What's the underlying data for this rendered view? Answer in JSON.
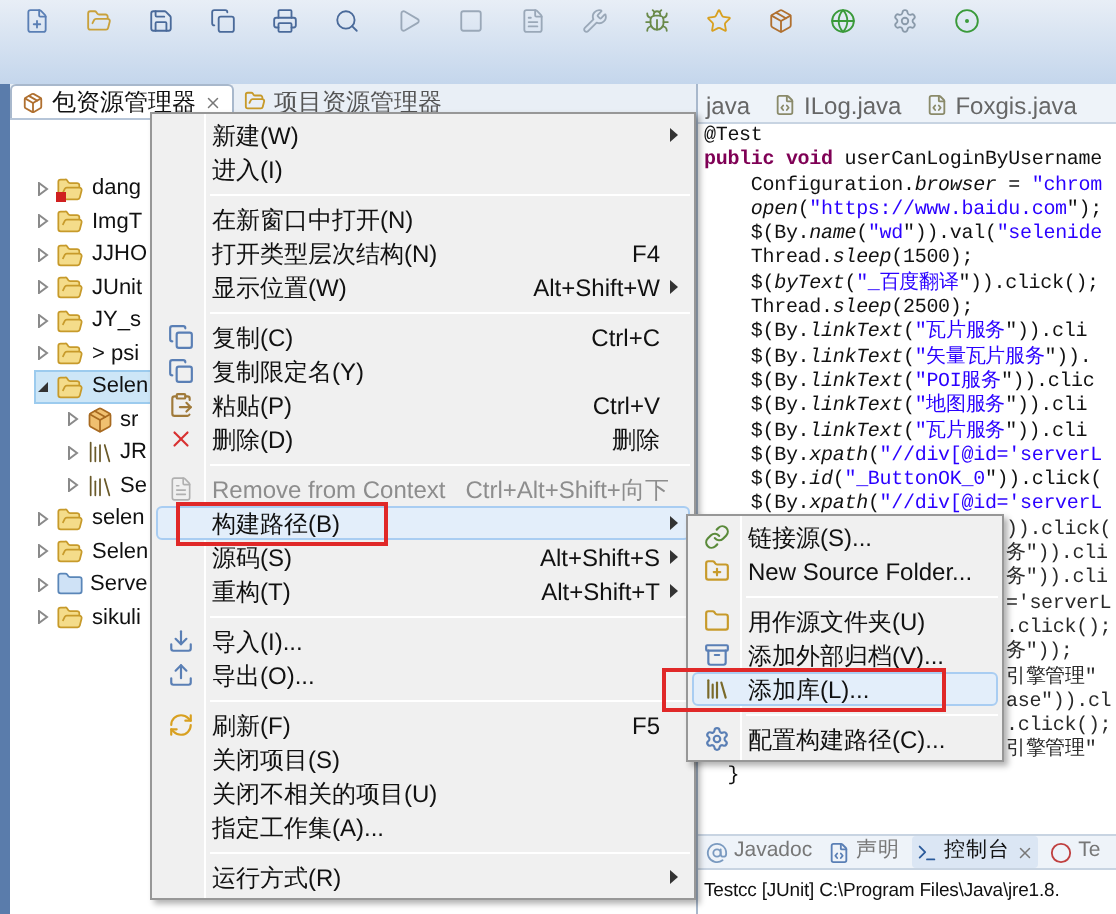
{
  "package_explorer": {
    "tabs": [
      {
        "label": "包资源管理器",
        "selected": true
      },
      {
        "label": "项目资源管理器",
        "selected": false
      }
    ],
    "tree": [
      {
        "label": "dang",
        "kind": "project-error",
        "expanded": false,
        "selected": false
      },
      {
        "label": "ImgT",
        "kind": "project",
        "expanded": false,
        "selected": false
      },
      {
        "label": "JJHO",
        "kind": "project",
        "expanded": false,
        "selected": false
      },
      {
        "label": "JUnit",
        "kind": "project",
        "expanded": false,
        "selected": false
      },
      {
        "label": "JY_s",
        "kind": "project",
        "expanded": false,
        "selected": false
      },
      {
        "label": "> psi",
        "kind": "project",
        "expanded": false,
        "selected": false
      },
      {
        "label": "Selen",
        "kind": "project",
        "expanded": true,
        "selected": true,
        "children": [
          {
            "label": "sr",
            "kind": "source",
            "expanded": false,
            "selected": false
          },
          {
            "label": "JR",
            "kind": "library",
            "expanded": false,
            "selected": false
          },
          {
            "label": "Se",
            "kind": "library",
            "expanded": false,
            "selected": false
          }
        ]
      },
      {
        "label": "selen",
        "kind": "project",
        "expanded": false,
        "selected": false
      },
      {
        "label": "Selen",
        "kind": "project",
        "expanded": false,
        "selected": false
      },
      {
        "label": "Serve",
        "kind": "folder",
        "expanded": false,
        "selected": false
      },
      {
        "label": "sikuli",
        "kind": "project",
        "expanded": false,
        "selected": false
      }
    ]
  },
  "editor": {
    "tabs": [
      {
        "label": "java"
      },
      {
        "label": "ILog.java"
      },
      {
        "label": "Foxgis.java"
      }
    ],
    "lines": [
      {
        "kind": "code",
        "text": "@Test"
      },
      {
        "kind": "code",
        "text": "**public void** userCanLoginByUsername"
      },
      {
        "kind": "code",
        "text": "    Configuration.*browser* = \"chrom"
      },
      {
        "kind": "code",
        "text": "    *open*(\"https://www.baidu.com\");"
      },
      {
        "kind": "code",
        "text": "    $(By.*name*(\"wd\")).val(\"selenide"
      },
      {
        "kind": "code",
        "text": "    Thread.*sleep*(1500);"
      },
      {
        "kind": "code",
        "text": "    $(*byText*(\"_百度翻译\")).click();"
      },
      {
        "kind": "code",
        "text": "    Thread.*sleep*(2500);"
      },
      {
        "kind": "code",
        "text": "    $(By.*linkText*(\"瓦片服务\")).cli"
      },
      {
        "kind": "code",
        "text": "    $(By.*linkText*(\"矢量瓦片服务\"))."
      },
      {
        "kind": "code",
        "text": "    $(By.*linkText*(\"POI服务\")).clic"
      },
      {
        "kind": "code",
        "text": "    $(By.*linkText*(\"地图服务\")).cli"
      },
      {
        "kind": "code",
        "text": "    $(By.*linkText*(\"瓦片服务\")).cli"
      },
      {
        "kind": "code",
        "text": "    $(By.*xpath*(\"//div[@id='serverL"
      },
      {
        "kind": "code",
        "text": "    $(By.*id*(\"_ButtonOK_0\")).click("
      },
      {
        "kind": "code",
        "text": "    $(By.*xpath*(\"//div[@id='serverL"
      },
      {
        "kind": "fragment",
        "text": ")).click("
      },
      {
        "kind": "fragment",
        "text": "务\")).cli"
      },
      {
        "kind": "fragment",
        "text": "务\")).cli"
      },
      {
        "kind": "fragment",
        "text": "='serverL"
      },
      {
        "kind": "fragment",
        "text": ".click();"
      },
      {
        "kind": "fragment",
        "text": "务\"));"
      },
      {
        "kind": "fragment",
        "text": "引擎管理\""
      },
      {
        "kind": "fragment",
        "text": "ase\")).cl"
      },
      {
        "kind": "fragment",
        "text": ".click();"
      },
      {
        "kind": "fragment",
        "text": "引擎管理\""
      },
      {
        "kind": "code",
        "text": "  }"
      }
    ]
  },
  "console": {
    "tabs": [
      {
        "label": "Javadoc",
        "selected": false
      },
      {
        "label": "声明",
        "selected": false
      },
      {
        "label": "控制台",
        "selected": true
      },
      {
        "label": "Te",
        "selected": false
      }
    ],
    "text": "Testcc [JUnit] C:\\Program Files\\Java\\jre1.8."
  },
  "context_menu": {
    "items": [
      {
        "kind": "item",
        "label": "新建(W)",
        "submenu": true,
        "disabled": false,
        "selected": false,
        "boxed": false
      },
      {
        "kind": "item",
        "label": "进入(I)",
        "submenu": false,
        "disabled": false,
        "selected": false,
        "boxed": false
      },
      {
        "kind": "separator"
      },
      {
        "kind": "item",
        "label": "在新窗口中打开(N)",
        "submenu": false,
        "disabled": false,
        "selected": false,
        "boxed": false
      },
      {
        "kind": "item",
        "label": "打开类型层次结构(N)",
        "shortcut": "F4",
        "submenu": false,
        "disabled": false,
        "selected": false,
        "boxed": false
      },
      {
        "kind": "item",
        "label": "显示位置(W)",
        "shortcut": "Alt+Shift+W",
        "submenu": true,
        "disabled": false,
        "selected": false,
        "boxed": false
      },
      {
        "kind": "separator"
      },
      {
        "kind": "item",
        "label": "复制(C)",
        "shortcut": "Ctrl+C",
        "submenu": false,
        "disabled": false,
        "selected": false,
        "boxed": false
      },
      {
        "kind": "item",
        "label": "复制限定名(Y)",
        "submenu": false,
        "disabled": false,
        "selected": false,
        "boxed": false
      },
      {
        "kind": "item",
        "label": "粘贴(P)",
        "shortcut": "Ctrl+V",
        "submenu": false,
        "disabled": false,
        "selected": false,
        "boxed": false
      },
      {
        "kind": "item",
        "label": "删除(D)",
        "shortcut": "删除",
        "submenu": false,
        "disabled": false,
        "selected": false,
        "boxed": false
      },
      {
        "kind": "separator"
      },
      {
        "kind": "item",
        "label": "Remove from Context",
        "shortcut": "Ctrl+Alt+Shift+向下",
        "submenu": false,
        "disabled": true,
        "selected": false,
        "boxed": false
      },
      {
        "kind": "item",
        "label": "构建路径(B)",
        "submenu": true,
        "disabled": false,
        "selected": true,
        "boxed": true
      },
      {
        "kind": "item",
        "label": "源码(S)",
        "shortcut": "Alt+Shift+S",
        "submenu": true,
        "disabled": false,
        "selected": false,
        "boxed": false
      },
      {
        "kind": "item",
        "label": "重构(T)",
        "shortcut": "Alt+Shift+T",
        "submenu": true,
        "disabled": false,
        "selected": false,
        "boxed": false
      },
      {
        "kind": "separator"
      },
      {
        "kind": "item",
        "label": "导入(I)...",
        "submenu": false,
        "disabled": false,
        "selected": false,
        "boxed": false
      },
      {
        "kind": "item",
        "label": "导出(O)...",
        "submenu": false,
        "disabled": false,
        "selected": false,
        "boxed": false
      },
      {
        "kind": "separator"
      },
      {
        "kind": "item",
        "label": "刷新(F)",
        "shortcut": "F5",
        "submenu": false,
        "disabled": false,
        "selected": false,
        "boxed": false
      },
      {
        "kind": "item",
        "label": "关闭项目(S)",
        "submenu": false,
        "disabled": false,
        "selected": false,
        "boxed": false
      },
      {
        "kind": "item",
        "label": "关闭不相关的项目(U)",
        "submenu": false,
        "disabled": false,
        "selected": false,
        "boxed": false
      },
      {
        "kind": "item",
        "label": "指定工作集(A)...",
        "submenu": false,
        "disabled": false,
        "selected": false,
        "boxed": false
      },
      {
        "kind": "separator"
      },
      {
        "kind": "item",
        "label": "运行方式(R)",
        "submenu": true,
        "disabled": false,
        "selected": false,
        "boxed": false
      }
    ]
  },
  "build_path_submenu": {
    "items": [
      {
        "kind": "item",
        "label": "链接源(S)...",
        "selected": false,
        "boxed": false
      },
      {
        "kind": "item",
        "label": "New Source Folder...",
        "selected": false,
        "boxed": false
      },
      {
        "kind": "separator"
      },
      {
        "kind": "item",
        "label": "用作源文件夹(U)",
        "selected": false,
        "boxed": false
      },
      {
        "kind": "item",
        "label": "添加外部归档(V)...",
        "selected": false,
        "boxed": false
      },
      {
        "kind": "item",
        "label": "添加库(L)...",
        "selected": true,
        "boxed": true
      },
      {
        "kind": "separator"
      },
      {
        "kind": "item",
        "label": "配置构建路径(C)...",
        "selected": false,
        "boxed": false
      }
    ]
  }
}
